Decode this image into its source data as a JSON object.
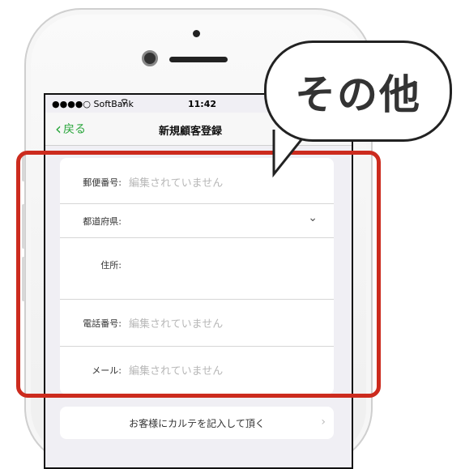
{
  "status": {
    "carrier": "●●●●○ SoftBank",
    "time": "11:42"
  },
  "nav": {
    "back_label": "戻る",
    "title": "新規顧客登録"
  },
  "form": {
    "postal": {
      "label": "郵便番号:",
      "placeholder": "編集されていません"
    },
    "prefecture": {
      "label": "都道府県:"
    },
    "address": {
      "label": "住所:"
    },
    "phone": {
      "label": "電話番号:",
      "placeholder": "編集されていません"
    },
    "email": {
      "label": "メール:",
      "placeholder": "編集されていません"
    }
  },
  "karte_button": {
    "label": "お客様にカルテを記入して頂く"
  },
  "callout": {
    "text": "その他"
  },
  "colors": {
    "accent": "#2aa63c",
    "highlight": "#cc2b1e"
  }
}
